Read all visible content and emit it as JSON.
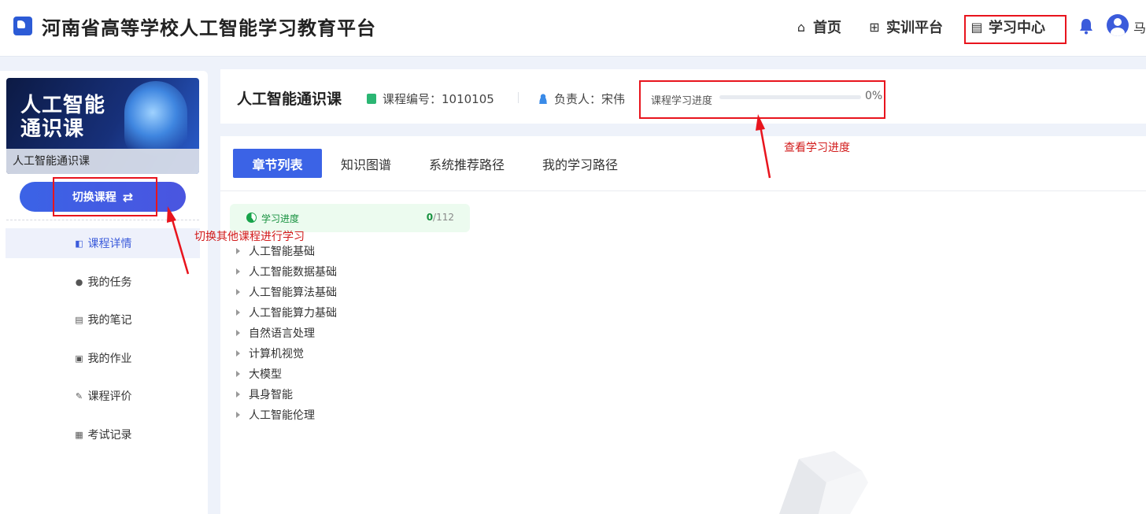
{
  "header": {
    "site_title": "河南省高等学校人工智能学习教育平台",
    "nav": [
      {
        "label": "首页",
        "icon": "home-icon"
      },
      {
        "label": "实训平台",
        "icon": "grid-icon"
      },
      {
        "label": "学习中心",
        "icon": "book-icon"
      }
    ],
    "user_name": "马"
  },
  "sidebar": {
    "cover_title_line1": "人工智能",
    "cover_title_line2": "通识课",
    "cover_caption": "人工智能通识课",
    "switch_label": "切换课程",
    "menu": [
      {
        "label": "课程详情",
        "icon": "book-open-icon",
        "active": true
      },
      {
        "label": "我的任务",
        "icon": "user-task-icon",
        "active": false
      },
      {
        "label": "我的笔记",
        "icon": "note-icon",
        "active": false
      },
      {
        "label": "我的作业",
        "icon": "homework-icon",
        "active": false
      },
      {
        "label": "课程评价",
        "icon": "edit-icon",
        "active": false
      },
      {
        "label": "考试记录",
        "icon": "exam-icon",
        "active": false
      }
    ]
  },
  "course": {
    "title": "人工智能通识课",
    "code_label": "课程编号：1010105",
    "owner_label": "负责人：宋伟",
    "progress_label": "课程学习进度",
    "progress_value": 0,
    "progress_text": "0%"
  },
  "tabs": [
    "章节列表",
    "知识图谱",
    "系统推荐路径",
    "我的学习路径"
  ],
  "chapter_progress": {
    "label": "学习进度",
    "done": "0",
    "total": "/112"
  },
  "chapters": [
    "人工智能基础",
    "人工智能数据基础",
    "人工智能算法基础",
    "人工智能算力基础",
    "自然语言处理",
    "计算机视觉",
    "大模型",
    "具身智能",
    "人工智能伦理"
  ],
  "annotations": {
    "switch_note": "切换其他课程进行学习",
    "progress_note": "查看学习进度"
  },
  "colors": {
    "accent": "#3b63e6",
    "annotation_red": "#e8141d",
    "progress_green": "#17913f"
  }
}
